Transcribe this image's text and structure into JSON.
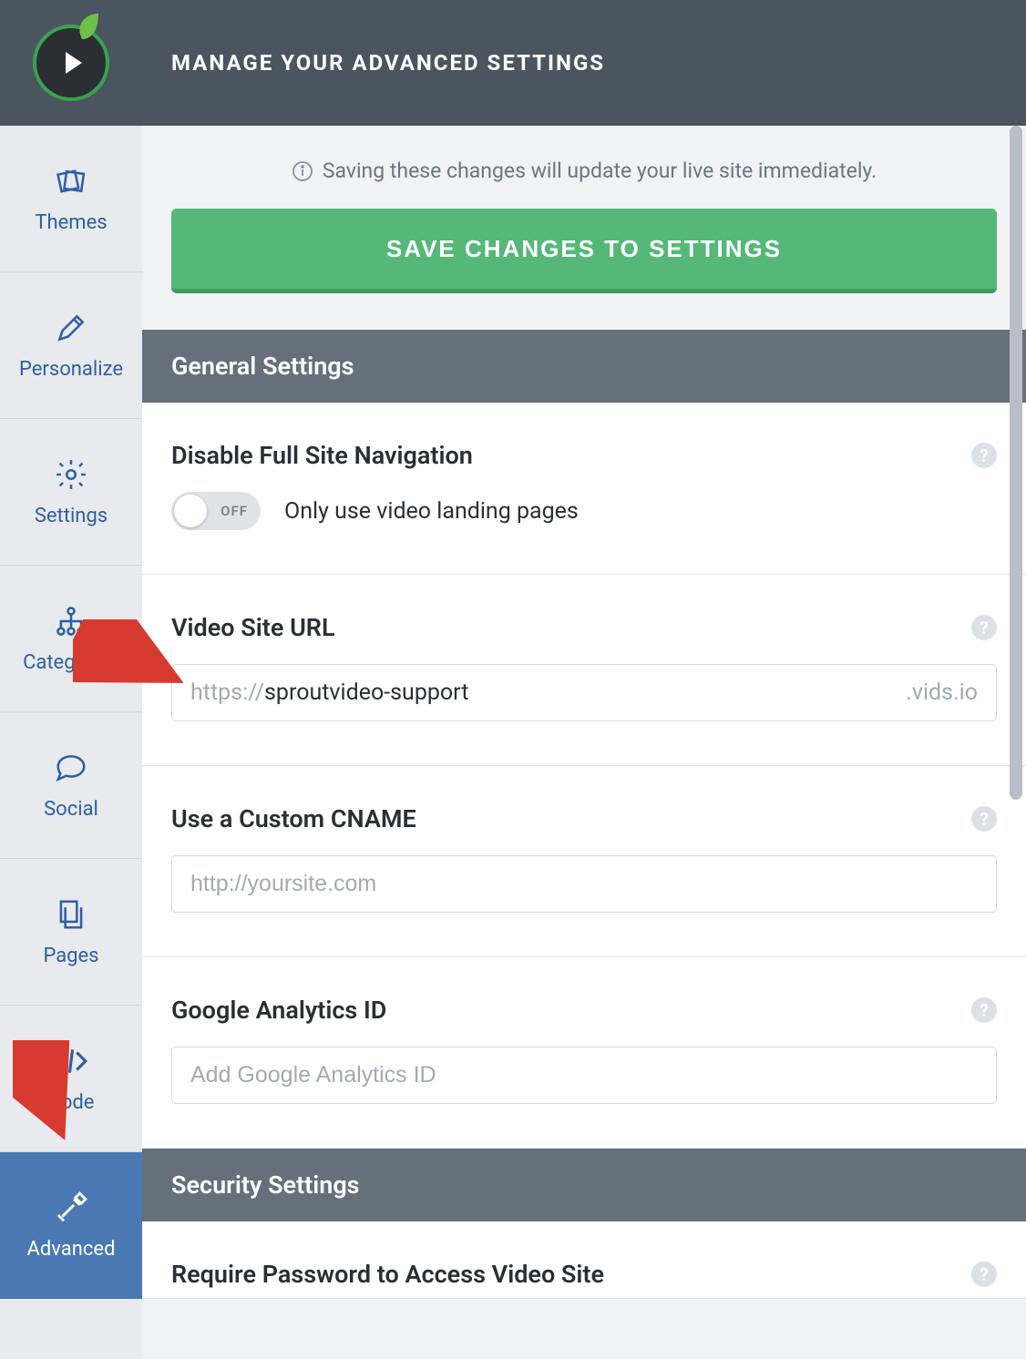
{
  "header": {
    "title": "MANAGE YOUR ADVANCED SETTINGS"
  },
  "sidebar": {
    "items": [
      {
        "label": "Themes"
      },
      {
        "label": "Personalize"
      },
      {
        "label": "Settings"
      },
      {
        "label": "Categories"
      },
      {
        "label": "Social"
      },
      {
        "label": "Pages"
      },
      {
        "label": "Code"
      },
      {
        "label": "Advanced"
      }
    ]
  },
  "save": {
    "info": "Saving these changes will update your live site immediately.",
    "button": "SAVE CHANGES TO SETTINGS"
  },
  "sections": {
    "general": {
      "title": "General Settings",
      "disable_nav": {
        "heading": "Disable Full Site Navigation",
        "toggle_state": "OFF",
        "desc": "Only use video landing pages"
      },
      "site_url": {
        "heading": "Video Site URL",
        "prefix": "https://",
        "value": "sproutvideo-support",
        "suffix": ".vids.io"
      },
      "cname": {
        "heading": "Use a Custom CNAME",
        "placeholder": "http://yoursite.com"
      },
      "analytics": {
        "heading": "Google Analytics ID",
        "placeholder": "Add Google Analytics ID"
      }
    },
    "security": {
      "title": "Security Settings",
      "password": {
        "heading": "Require Password to Access Video Site"
      }
    }
  }
}
